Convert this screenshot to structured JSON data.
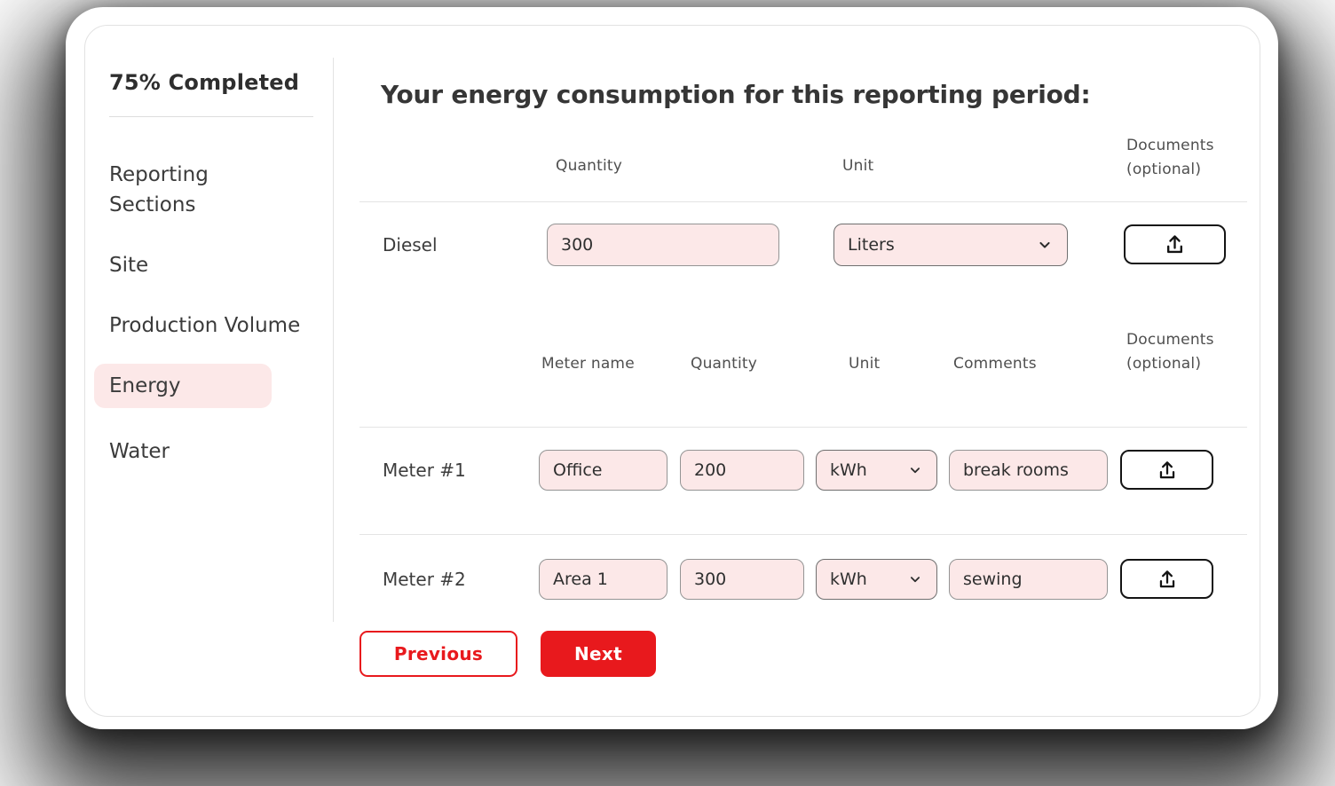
{
  "sidebar": {
    "progress_label": "75% Completed",
    "items": [
      {
        "label": "Reporting Sections",
        "active": false
      },
      {
        "label": "Site",
        "active": false
      },
      {
        "label": "Production Volume",
        "active": false
      },
      {
        "label": "Energy",
        "active": true
      },
      {
        "label": "Water",
        "active": false
      }
    ]
  },
  "main": {
    "title": "Your energy consumption for this reporting period:",
    "fuel_table": {
      "headers": {
        "quantity": "Quantity",
        "unit": "Unit",
        "documents_line1": "Documents",
        "documents_line2": "(optional)"
      },
      "rows": [
        {
          "label": "Diesel",
          "quantity": "300",
          "unit": "Liters"
        }
      ]
    },
    "meter_table": {
      "headers": {
        "meter_name": "Meter name",
        "quantity": "Quantity",
        "unit": "Unit",
        "comments": "Comments",
        "documents_line1": "Documents",
        "documents_line2": "(optional)"
      },
      "rows": [
        {
          "label": "Meter #1",
          "meter_name": "Office",
          "quantity": "200",
          "unit": "kWh",
          "comments": "break rooms"
        },
        {
          "label": "Meter #2",
          "meter_name": "Area 1",
          "quantity": "300",
          "unit": "kWh",
          "comments": "sewing"
        }
      ]
    },
    "buttons": {
      "previous": "Previous",
      "next": "Next"
    }
  },
  "icons": {
    "upload": "upload-icon",
    "chevron": "chevron-down-icon"
  },
  "colors": {
    "accent_red": "#E8191D",
    "field_pink": "#FCE8E8",
    "active_nav_pink": "#FCE8E8",
    "divider_gray": "#E4E4E4",
    "text_dark": "#363636"
  }
}
